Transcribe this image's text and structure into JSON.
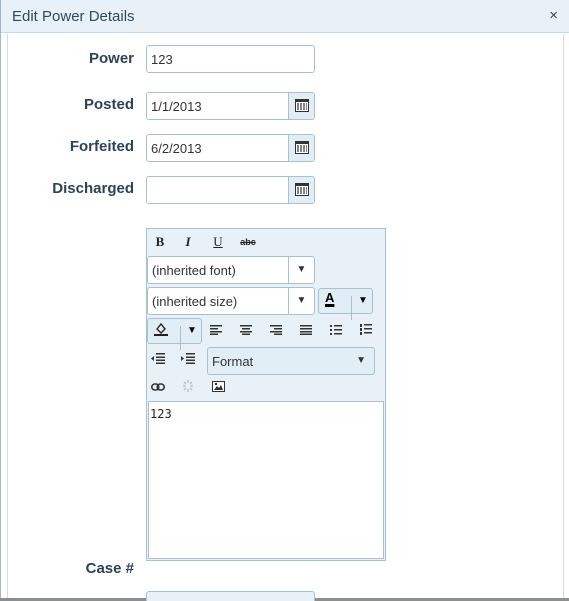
{
  "dialog": {
    "title": "Edit Power Details",
    "close_glyph": "×"
  },
  "form": {
    "power": {
      "label": "Power",
      "value": "123"
    },
    "posted": {
      "label": "Posted",
      "value": "1/1/2013"
    },
    "forfeited": {
      "label": "Forfeited",
      "value": "6/2/2013"
    },
    "discharged": {
      "label": "Discharged",
      "value": ""
    },
    "case": {
      "label": "Case #",
      "value": ""
    }
  },
  "editor": {
    "toolbar": {
      "bold": "B",
      "italic": "I",
      "underline": "U",
      "strikethrough": "abc",
      "font_name": "(inherited font)",
      "font_size": "(inherited size)",
      "fore_color_glyph": "A",
      "format": "Format",
      "dropdown_glyph": "▼"
    },
    "content": "123"
  },
  "icons": {
    "calendar": "calendar-icon",
    "link": "link-icon",
    "unlink": "unlink-icon",
    "image": "insert-image-icon",
    "paint_bucket": "background-color-icon",
    "outdent": "outdent-icon",
    "indent": "indent-icon"
  },
  "colors": {
    "accent_bg": "#e8f1f7",
    "border": "#a9c0d0",
    "label_text": "#2c4458"
  }
}
